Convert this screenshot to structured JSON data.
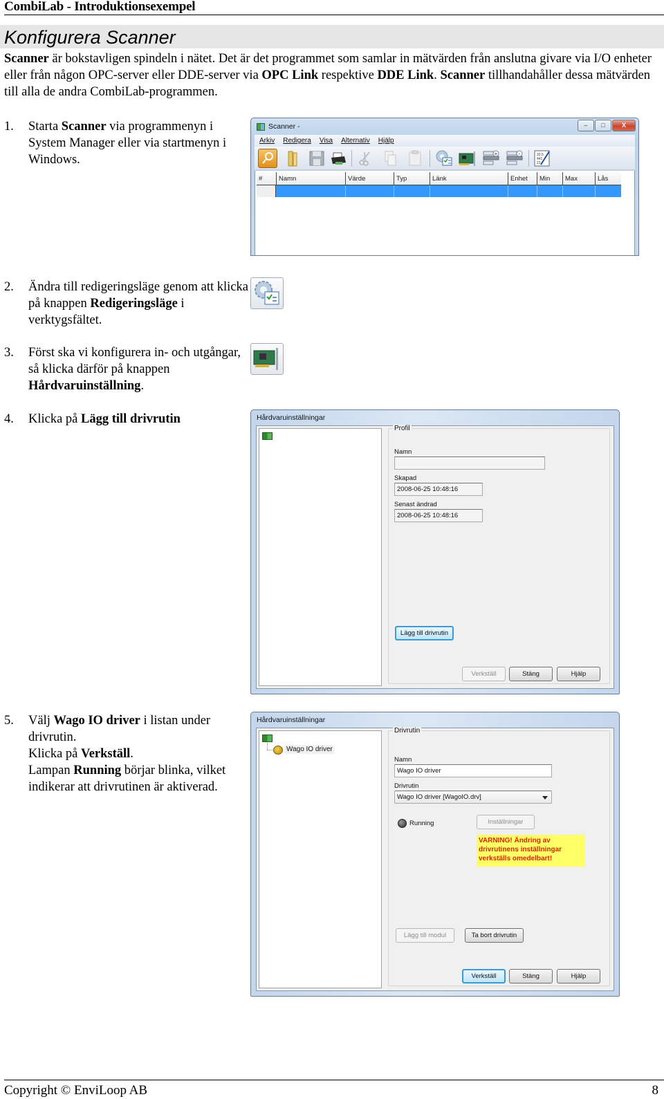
{
  "header": {
    "title": "CombiLab - Introduktionsexempel"
  },
  "section": {
    "title": "Konfigurera Scanner"
  },
  "intro": {
    "p1_bold": "Scanner",
    "p1_a": " är bokstavligen spindeln i nätet. Det är det programmet som samlar in mätvärden från anslutna givare via I/O enheter eller från någon OPC-server eller DDE-server via ",
    "p1_bold2": "OPC Link",
    "p1_b": " respektive ",
    "p1_bold3": "DDE Link",
    "p1_c": ". ",
    "p1_bold4": "Scanner",
    "p1_d": " tillhandahåller dessa mätvärden till alla de andra CombiLab-programmen."
  },
  "steps": [
    {
      "num": "1.",
      "a": "Starta ",
      "b": "Scanner",
      "c": " via programmenyn i System Manager eller via startmenyn i Windows."
    },
    {
      "num": "2.",
      "a": "Ändra till redigeringsläge genom att klicka på knappen ",
      "b": "Redigeringsläge",
      "c": " i verktygsfältet."
    },
    {
      "num": "3.",
      "a": "Först ska vi konfigurera in- och utgångar, så klicka därför på knappen ",
      "b": "Hårdvaruinställning",
      "c": "."
    },
    {
      "num": "4.",
      "a": "Klicka på ",
      "b": "Lägg till drivrutin",
      "c": ""
    },
    {
      "num": "5.",
      "a": "Välj ",
      "b": "Wago IO driver",
      "c": " i listan under drivrutin.",
      "d": "Klicka på ",
      "e": "Verkställ",
      "f": ".",
      "g": "Lampan ",
      "h": "Running",
      "i": " börjar blinka, vilket indikerar att drivrutinen är aktiverad."
    }
  ],
  "scanner_window": {
    "title": "Scanner -",
    "controls": {
      "minimize": "–",
      "maximize": "□",
      "close": "X"
    },
    "menu": [
      "Arkiv",
      "Redigera",
      "Visa",
      "Alternativ",
      "Hjälp"
    ],
    "toolbar": [
      "key-icon",
      "folder-open-icon",
      "save-icon",
      "print-icon",
      "cut-icon",
      "copy-icon",
      "paste-icon",
      "edit-mode-icon",
      "hardware-icon",
      "add-row-icon",
      "remove-row-icon",
      "calculator-icon"
    ],
    "columns": [
      "#",
      "Namn",
      "Värde",
      "Typ",
      "Länk",
      "Enhet",
      "Min",
      "Max",
      "Lås värde"
    ]
  },
  "dialog1": {
    "title": "Hårdvaruinställningar",
    "group_label": "Profil",
    "name_label": "Namn",
    "name_value": "",
    "created_label": "Skapad",
    "created_value": "2008-06-25 10:48:16",
    "modified_label": "Senast ändrad",
    "modified_value": "2008-06-25 10:48:16",
    "add_driver_button": "Lägg till drivrutin",
    "apply_button": "Verkställ",
    "close_button": "Stäng",
    "help_button": "Hjälp"
  },
  "dialog2": {
    "title": "Hårdvaruinställningar",
    "tree_item": "Wago IO driver",
    "group_label": "Drivrutin",
    "name_label": "Namn",
    "name_value": "Wago IO driver",
    "driver_label": "Drivrutin",
    "driver_value": "Wago IO driver [WagoIO.drv]",
    "running_label": "Running",
    "settings_button": "Inställningar",
    "warning": "VARNING! Ändring av drivrutinens inställningar verkställs omedelbart!",
    "add_module_button": "Lägg till modul",
    "remove_driver_button": "Ta bort drivrutin",
    "apply_button": "Verkställ",
    "close_button": "Stäng",
    "help_button": "Hjälp"
  },
  "footer": {
    "copyright": "Copyright © EnviLoop AB",
    "page": "8"
  }
}
